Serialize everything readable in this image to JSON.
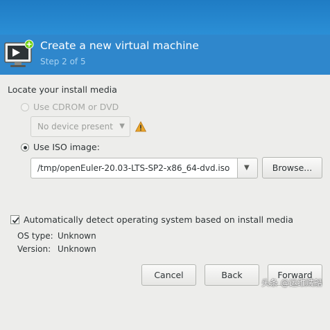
{
  "header": {
    "title": "Create a new virtual machine",
    "step": "Step 2 of 5"
  },
  "install_media": {
    "section_label": "Locate your install media",
    "cdrom_option_label": "Use CDROM or DVD",
    "cdrom_selected": false,
    "cdrom_enabled": false,
    "device_combo_value": "No device present",
    "iso_option_label": "Use ISO image:",
    "iso_selected": true,
    "iso_path": "/tmp/openEuler-20.03-LTS-SP2-x86_64-dvd.iso",
    "browse_label": "Browse..."
  },
  "os_detect": {
    "checkbox_label": "Automatically detect operating system based on install media",
    "checked": true,
    "os_type_label": "OS type:",
    "os_type_value": "Unknown",
    "version_label": "Version:",
    "version_value": "Unknown"
  },
  "footer": {
    "cancel_label": "Cancel",
    "back_label": "Back",
    "forward_label": "Forward"
  },
  "watermark": "头条 @运维贼船",
  "colors": {
    "header_bg": "#2f87cc",
    "step_text": "#a9d3f2",
    "warning": "#e9a52a"
  },
  "icons": {
    "header": "virtual-machine-monitor-icon",
    "warning": "warning-icon",
    "dropdown": "chevron-down-icon",
    "check": "checkmark-icon"
  }
}
